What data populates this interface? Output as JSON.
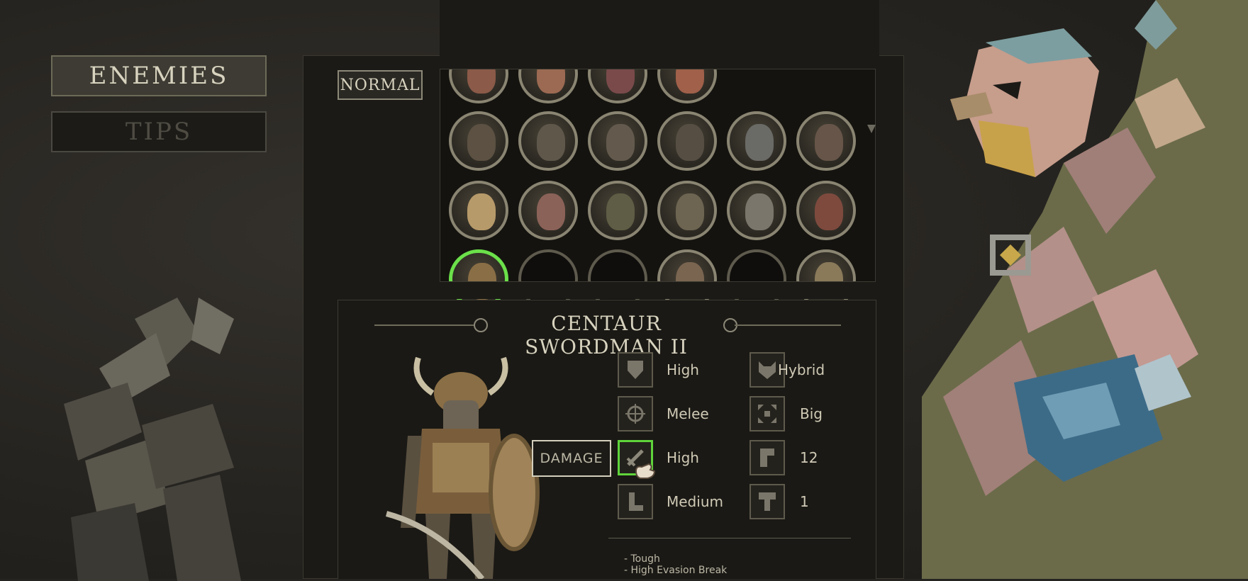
{
  "nav": {
    "enemies_label": "ENEMIES",
    "tips_label": "TIPS"
  },
  "difficulty": {
    "label": "NORMAL"
  },
  "enemy": {
    "name": "CENTAUR SWORDMAN II",
    "tooltip": "DAMAGE",
    "stats_left": [
      {
        "icon": "armor-shield-icon",
        "value": "High"
      },
      {
        "icon": "target-crosshair-icon",
        "value": "Melee"
      },
      {
        "icon": "sword-damage-icon",
        "value": "High"
      },
      {
        "icon": "boot-speed-icon",
        "value": "Medium"
      }
    ],
    "stats_right": [
      {
        "icon": "beast-mask-icon",
        "value": "Hybrid"
      },
      {
        "icon": "size-arrows-icon",
        "value": "Big"
      },
      {
        "icon": "flag-icon",
        "value": "12"
      },
      {
        "icon": "hammer-icon",
        "value": "1"
      }
    ],
    "traits": [
      "- Tough",
      "- High Evasion Break"
    ]
  },
  "colors": {
    "selected": "#6be04a",
    "highlight": "#5fd43b",
    "text": "#d8d3bf"
  }
}
